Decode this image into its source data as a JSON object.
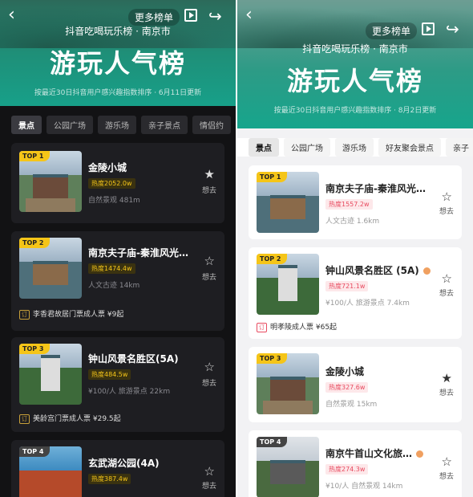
{
  "left": {
    "more": "更多榜单",
    "brand": "抖音吃喝玩乐榜 · 南京市",
    "title": "游玩人气榜",
    "subtitle": "按最近30日抖音用户感兴趣指数排序 · 6月11日更新",
    "tabs": [
      "景点",
      "公园广场",
      "游乐场",
      "亲子景点",
      "情侣约"
    ],
    "want": "想去",
    "items": [
      {
        "rank": "TOP 1",
        "name": "金陵小城",
        "heat": "热度2052.0w",
        "meta": "自然景观  481m",
        "ticket": ""
      },
      {
        "rank": "TOP 2",
        "name": "南京夫子庙-秦淮风光…",
        "heat": "热度1474.4w",
        "meta": "人文古迹  14km",
        "ticket": "李香君故居门票成人票 ¥9起"
      },
      {
        "rank": "TOP 3",
        "name": "钟山风景名胜区(5A)",
        "heat": "热度484.5w",
        "meta": "¥100/人  旅游景点  22km",
        "ticket": "美龄宫门票成人票 ¥29.5起"
      },
      {
        "rank": "TOP 4",
        "name": "玄武湖公园(4A)",
        "heat": "热度387.4w",
        "meta": "",
        "ticket": ""
      }
    ]
  },
  "right": {
    "more": "更多榜单",
    "brand": "抖音吃喝玩乐榜 · 南京市",
    "title": "游玩人气榜",
    "subtitle": "按最近30日抖音用户感兴趣指数排序 · 8月2日更新",
    "tabs": [
      "景点",
      "公园广场",
      "游乐场",
      "好友聚会景点",
      "亲子"
    ],
    "want": "想去",
    "items": [
      {
        "rank": "TOP 1",
        "name": "南京夫子庙-秦淮风光…",
        "heat": "热度1557.2w",
        "meta": "人文古迹  1.6km",
        "ticket": ""
      },
      {
        "rank": "TOP 2",
        "name": "钟山风景名胜区 (5A)",
        "heat": "热度721.1w",
        "meta": "¥100/人  旅游景点  7.4km",
        "ticket": "明孝陵成人票 ¥65起"
      },
      {
        "rank": "TOP 3",
        "name": "金陵小城",
        "heat": "热度327.6w",
        "meta": "自然景观  15km",
        "ticket": ""
      },
      {
        "rank": "TOP 4",
        "name": "南京牛首山文化旅…",
        "heat": "热度274.3w",
        "meta": "¥10/人  自然景观  14km",
        "ticket": ""
      }
    ]
  }
}
